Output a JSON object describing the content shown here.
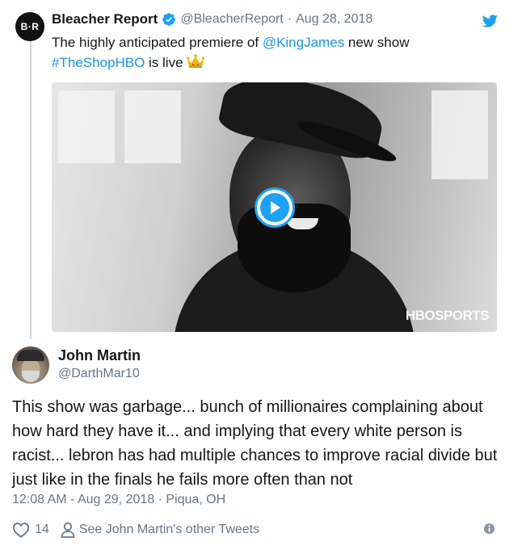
{
  "quoted_tweet": {
    "avatar_text": "B·R",
    "name": "Bleacher Report",
    "handle": "@BleacherReport",
    "separator": "·",
    "date": "Aug 28, 2018",
    "text_parts": {
      "t1": "The highly anticipated premiere of ",
      "mention": "@KingJames",
      "t2": " new show",
      "hashtag": "#TheShopHBO",
      "t3": " is live"
    },
    "media": {
      "watermark": "HBOSPORTS"
    }
  },
  "tweet": {
    "name": "John Martin",
    "handle": "@DarthMar10",
    "text": "This show was garbage... bunch of millionaires complaining  about how hard they have it... and implying that every white person is racist... lebron has had multiple chances to improve racial divide but just like in the finals he fails more often than not",
    "meta": "12:08 AM - Aug 29, 2018 · Piqua, OH",
    "like_count": "14",
    "other_tweets_label": "See John Martin's other Tweets"
  },
  "colors": {
    "link": "#1b95e0",
    "twitter_blue": "#1da1f2",
    "secondary_text": "#657786",
    "primary_text": "#14171a"
  },
  "icons": [
    "verified-badge-icon",
    "twitter-bird-icon",
    "crown-emoji-icon",
    "play-icon",
    "heart-icon",
    "person-icon",
    "info-icon"
  ]
}
